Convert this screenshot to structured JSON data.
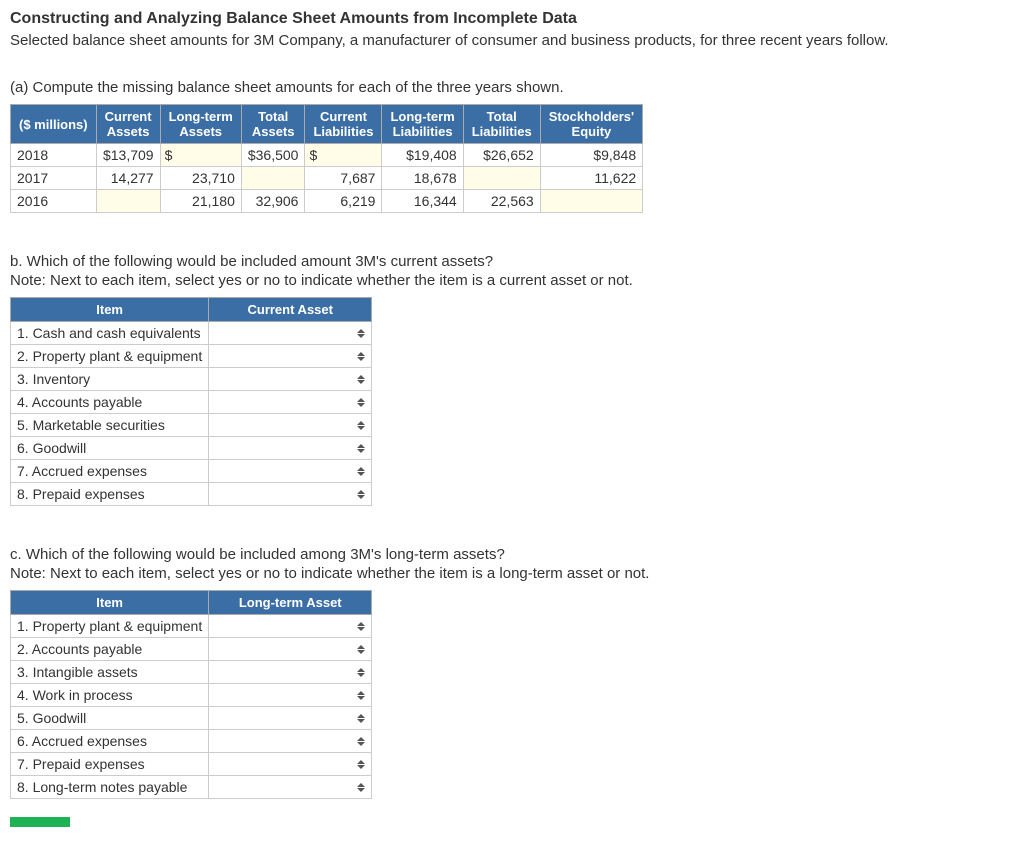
{
  "heading": "Constructing and Analyzing Balance Sheet Amounts from Incomplete Data",
  "subheading": "Selected balance sheet amounts for 3M Company, a manufacturer of consumer and business products, for three recent years follow.",
  "partA": {
    "prompt": "(a) Compute the missing balance sheet amounts for each of the three years shown.",
    "headers": [
      "($ millions)",
      "Current Assets",
      "Long-term Assets",
      "Total Assets",
      "Current Liabilities",
      "Long-term Liabilities",
      "Total Liabilities",
      "Stockholders' Equity"
    ],
    "rows": [
      {
        "year": "2018",
        "ca": "$13,709",
        "lta": "$",
        "ta": "$36,500",
        "cl": "$",
        "ltl": "$19,408",
        "tl": "$26,652",
        "se": "$9,848",
        "inputs": {
          "lta": true,
          "cl": true
        }
      },
      {
        "year": "2017",
        "ca": "14,277",
        "lta": "23,710",
        "ta": "",
        "cl": "7,687",
        "ltl": "18,678",
        "tl": "",
        "se": "11,622",
        "inputs": {
          "ta": true,
          "tl": true
        }
      },
      {
        "year": "2016",
        "ca": "",
        "lta": "21,180",
        "ta": "32,906",
        "cl": "6,219",
        "ltl": "16,344",
        "tl": "22,563",
        "se": "",
        "inputs": {
          "ca": true,
          "se": true
        }
      }
    ]
  },
  "partB": {
    "prompt": "b. Which of the following would be included amount 3M's current assets?",
    "note": "Note: Next to each item, select yes or no to indicate whether the item is a current asset or not.",
    "headers": [
      "Item",
      "Current Asset"
    ],
    "items": [
      "1. Cash and cash equivalents",
      "2. Property plant & equipment",
      "3. Inventory",
      "4. Accounts payable",
      "5. Marketable securities",
      "6. Goodwill",
      "7. Accrued expenses",
      "8. Prepaid expenses"
    ]
  },
  "partC": {
    "prompt": "c. Which of the following would be included among 3M's long-term assets?",
    "note": "Note: Next to each item, select yes or no to indicate whether the item is a long-term asset or not.",
    "headers": [
      "Item",
      "Long-term Asset"
    ],
    "items": [
      "1. Property plant & equipment",
      "2. Accounts payable",
      "3. Intangible assets",
      "4. Work in process",
      "5. Goodwill",
      "6. Accrued expenses",
      "7. Prepaid expenses",
      "8. Long-term notes payable"
    ]
  }
}
